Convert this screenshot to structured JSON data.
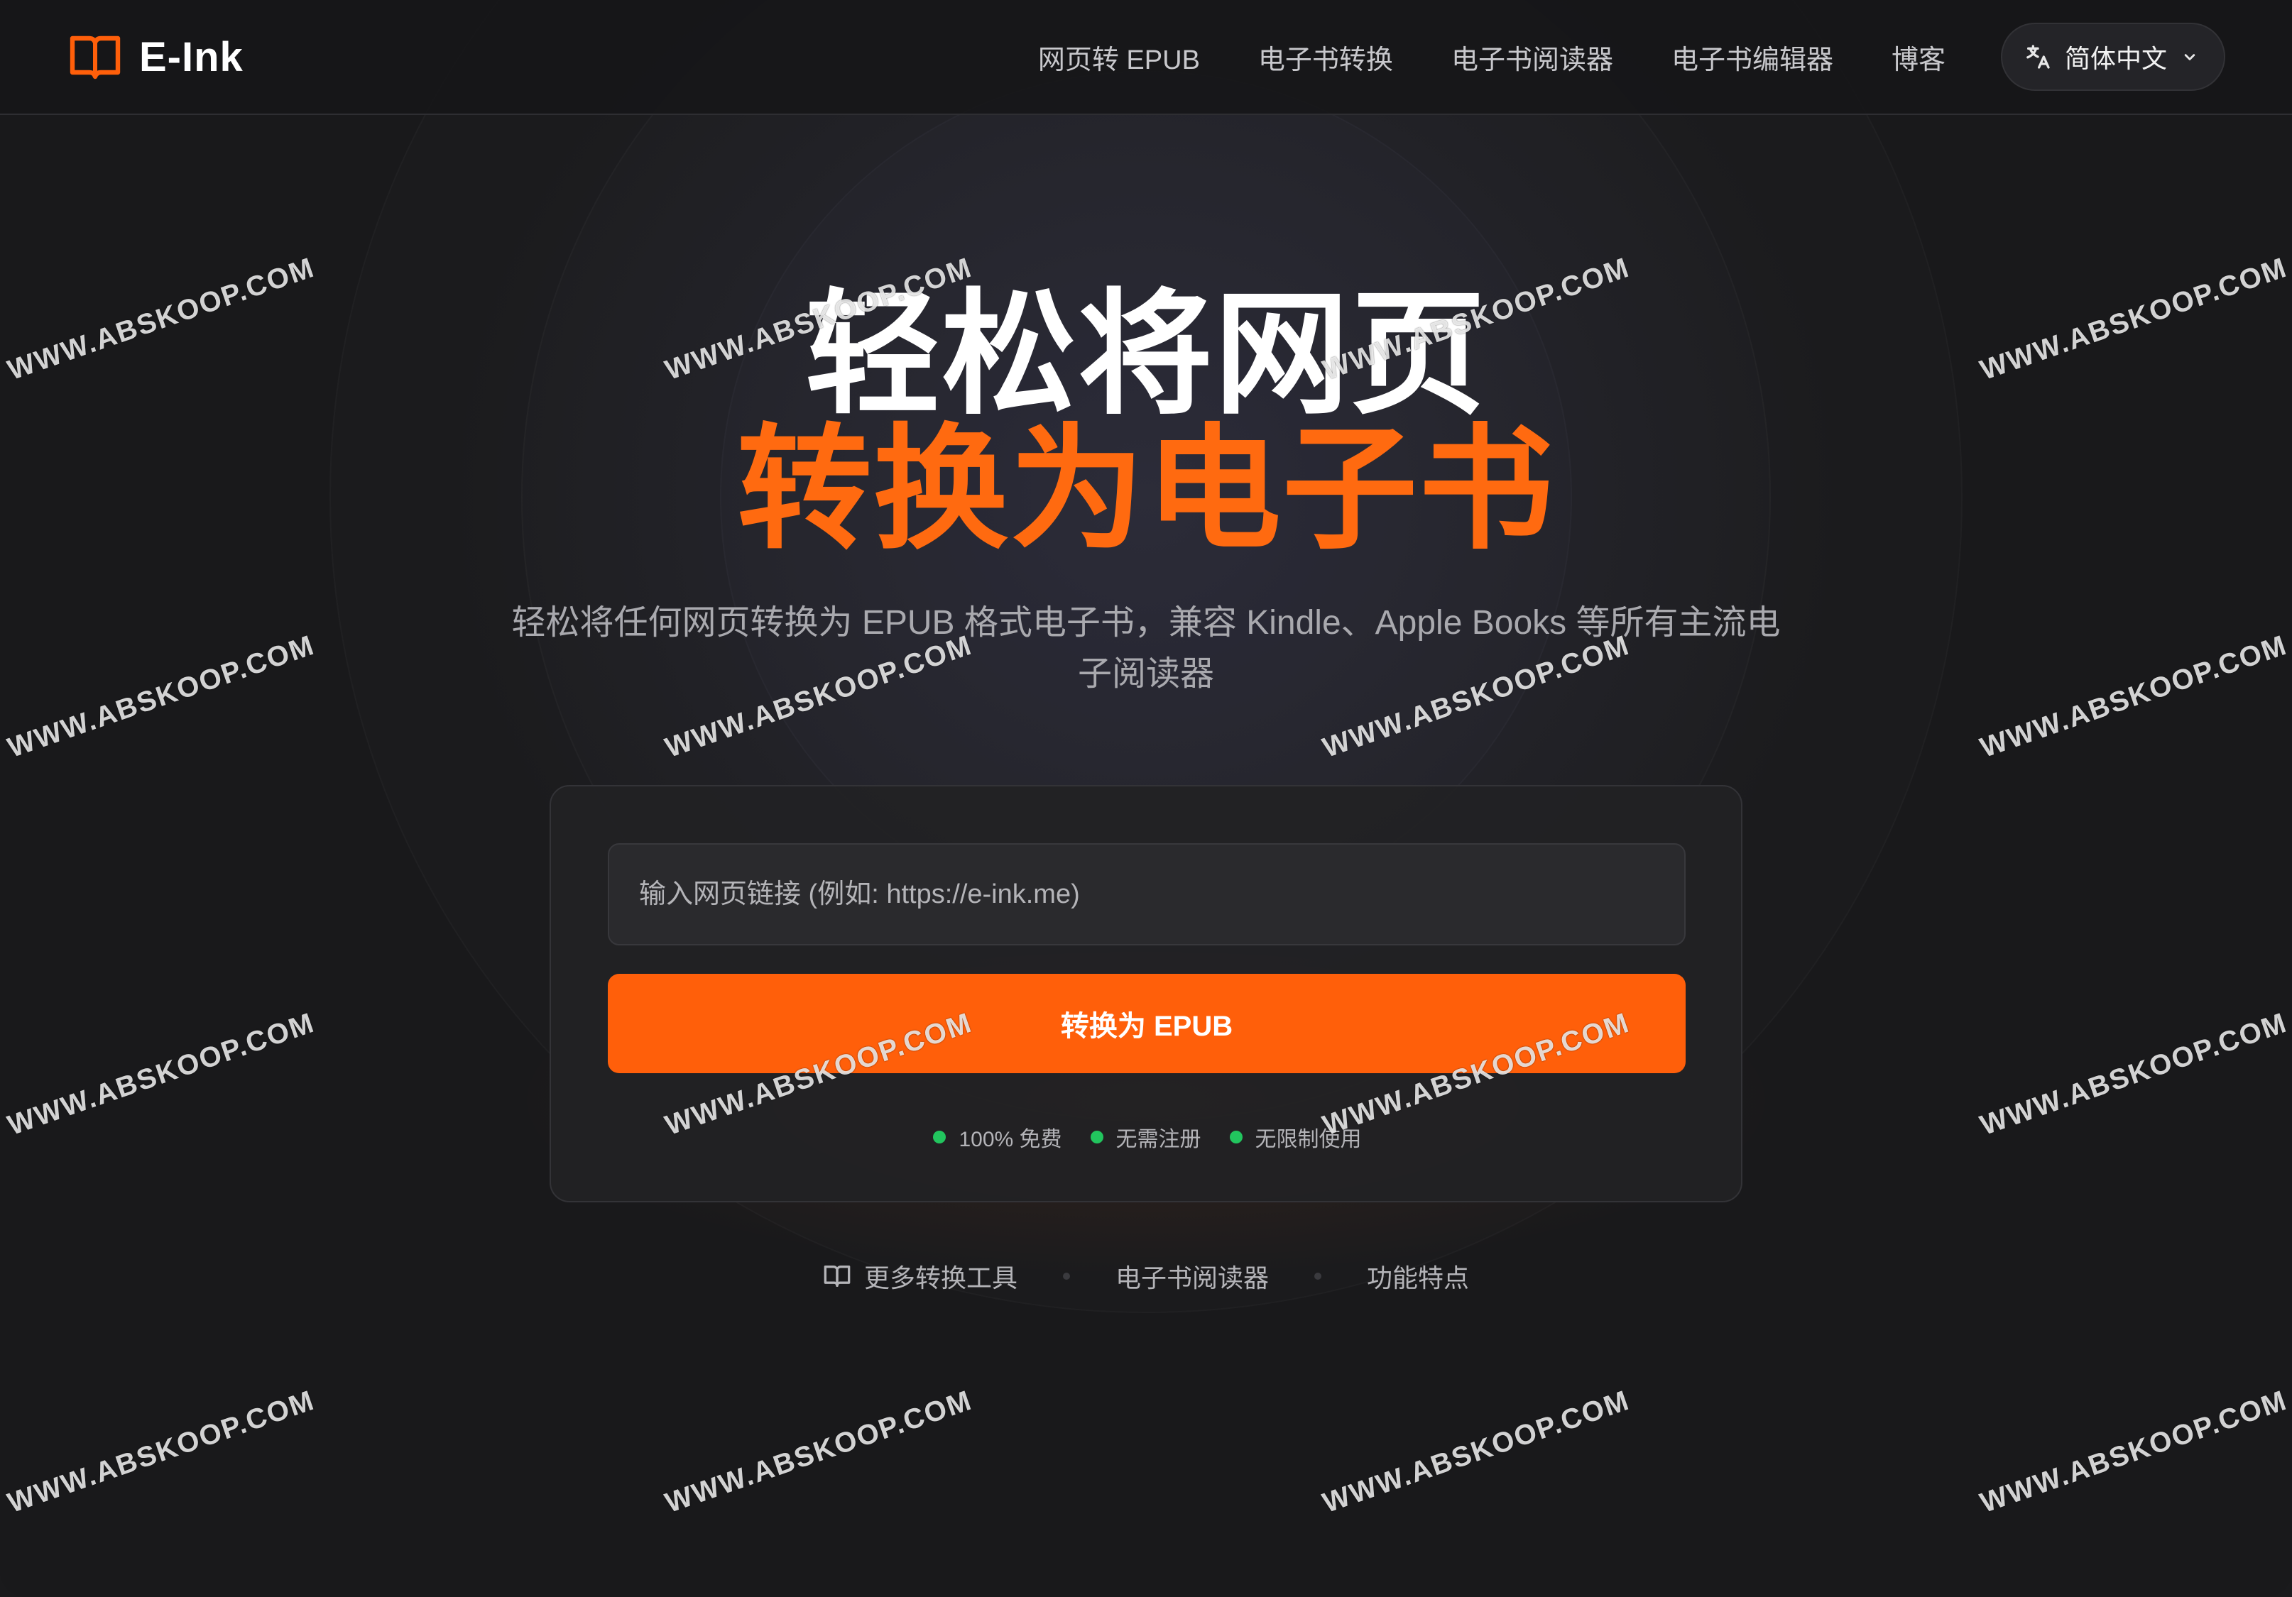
{
  "app": {
    "logo_text": "E-Ink",
    "accent_color": "#ff5f0a"
  },
  "nav": {
    "items": [
      {
        "label": "网页转 EPUB"
      },
      {
        "label": "电子书转换"
      },
      {
        "label": "电子书阅读器"
      },
      {
        "label": "电子书编辑器"
      },
      {
        "label": "博客"
      }
    ],
    "language": {
      "label": "简体中文",
      "icon": "translate-icon"
    }
  },
  "hero": {
    "title_line1": "轻松将网页",
    "title_line2": "转换为电子书",
    "subtitle": "轻松将任何网页转换为 EPUB 格式电子书，兼容 Kindle、Apple Books 等所有主流电子阅读器"
  },
  "converter": {
    "url_placeholder": "输入网页链接 (例如: https://e-ink.me)",
    "url_value": "",
    "button_label": "转换为 EPUB",
    "features": [
      {
        "label": "100% 免费",
        "color": "#22c55e"
      },
      {
        "label": "无需注册",
        "color": "#22c55e"
      },
      {
        "label": "无限制使用",
        "color": "#22c55e"
      }
    ]
  },
  "footer_links": [
    {
      "label": "更多转换工具",
      "icon": "book-open-icon"
    },
    {
      "label": "电子书阅读器"
    },
    {
      "label": "功能特点"
    }
  ],
  "watermark": {
    "text": "WWW.ABSKOOP.COM"
  }
}
